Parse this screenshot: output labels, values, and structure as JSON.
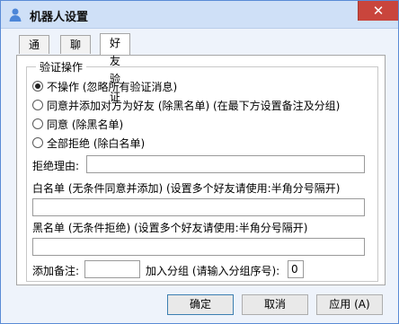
{
  "window": {
    "title": "机器人设置",
    "close_glyph": "✕",
    "app_icon": "person-icon",
    "accent": "#cfe0f7"
  },
  "tabs": [
    {
      "label": "通常"
    },
    {
      "label": "聊天"
    },
    {
      "label": "好友验证"
    }
  ],
  "verify": {
    "group_title": "验证操作",
    "options": [
      {
        "label": "不操作 (忽略所有验证消息)",
        "checked": true
      },
      {
        "label": "同意并添加对方为好友 (除黑名单) (在最下方设置备注及分组)",
        "checked": false
      },
      {
        "label": "同意 (除黑名单)",
        "checked": false
      },
      {
        "label": "全部拒绝 (除白名单)",
        "checked": false
      }
    ],
    "reject_reason_label": "拒绝理由:",
    "reject_reason_value": "",
    "whitelist_label": "白名单 (无条件同意并添加) (设置多个好友请使用:半角分号隔开)",
    "whitelist_value": "",
    "blacklist_label": "黑名单 (无条件拒绝) (设置多个好友请使用:半角分号隔开)",
    "blacklist_value": "",
    "remark_label": "添加备注:",
    "remark_value": "",
    "group_label": "加入分组 (请输入分组序号):",
    "group_value": "0"
  },
  "buttons": {
    "ok": "确定",
    "cancel": "取消",
    "apply": "应用 (A)"
  }
}
